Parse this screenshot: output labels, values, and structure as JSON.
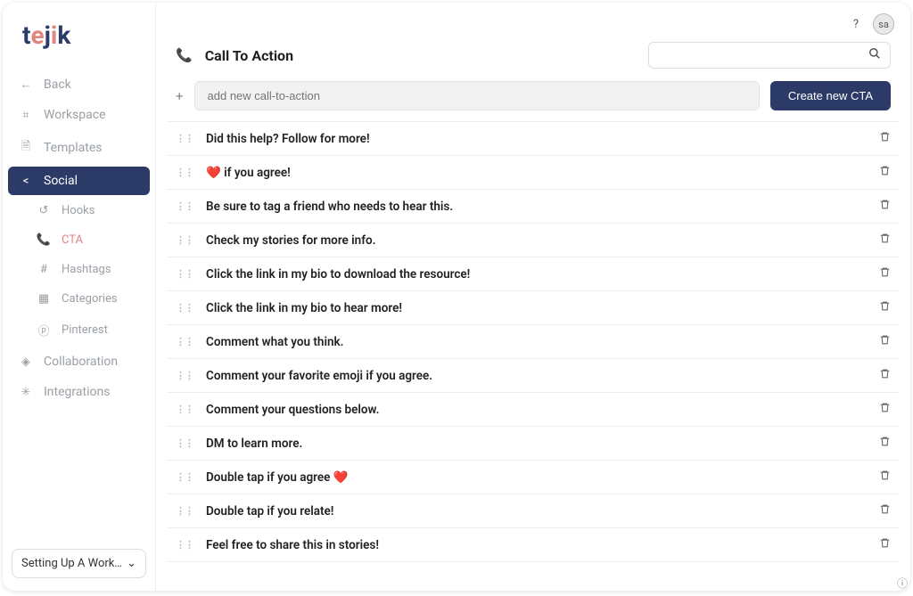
{
  "brand": "tejik",
  "topbar": {
    "avatar_initials": "sa"
  },
  "sidebar": {
    "back": "Back",
    "workspace": "Workspace",
    "templates": "Templates",
    "social": "Social",
    "sub": {
      "hooks": "Hooks",
      "cta": "CTA",
      "hashtags": "Hashtags",
      "categories": "Categories",
      "pinterest": "Pinterest"
    },
    "collaboration": "Collaboration",
    "integrations": "Integrations",
    "footer_select": "Setting Up A Works…"
  },
  "page": {
    "title": "Call To Action",
    "add_placeholder": "add new call-to-action",
    "create_btn": "Create new CTA"
  },
  "cta_items": [
    "Did this help? Follow for more!",
    "❤️ if you agree!",
    "Be sure to tag a friend who needs to hear this.",
    "Check my stories for more info.",
    "Click the link in my bio to download the resource!",
    "Click the link in my bio to hear more!",
    "Comment what you think.",
    "Comment your favorite emoji if you agree.",
    "Comment your questions below.",
    "DM to learn more.",
    "Double tap if you agree ❤️",
    "Double tap if you relate!",
    "Feel free to share this in stories!"
  ]
}
